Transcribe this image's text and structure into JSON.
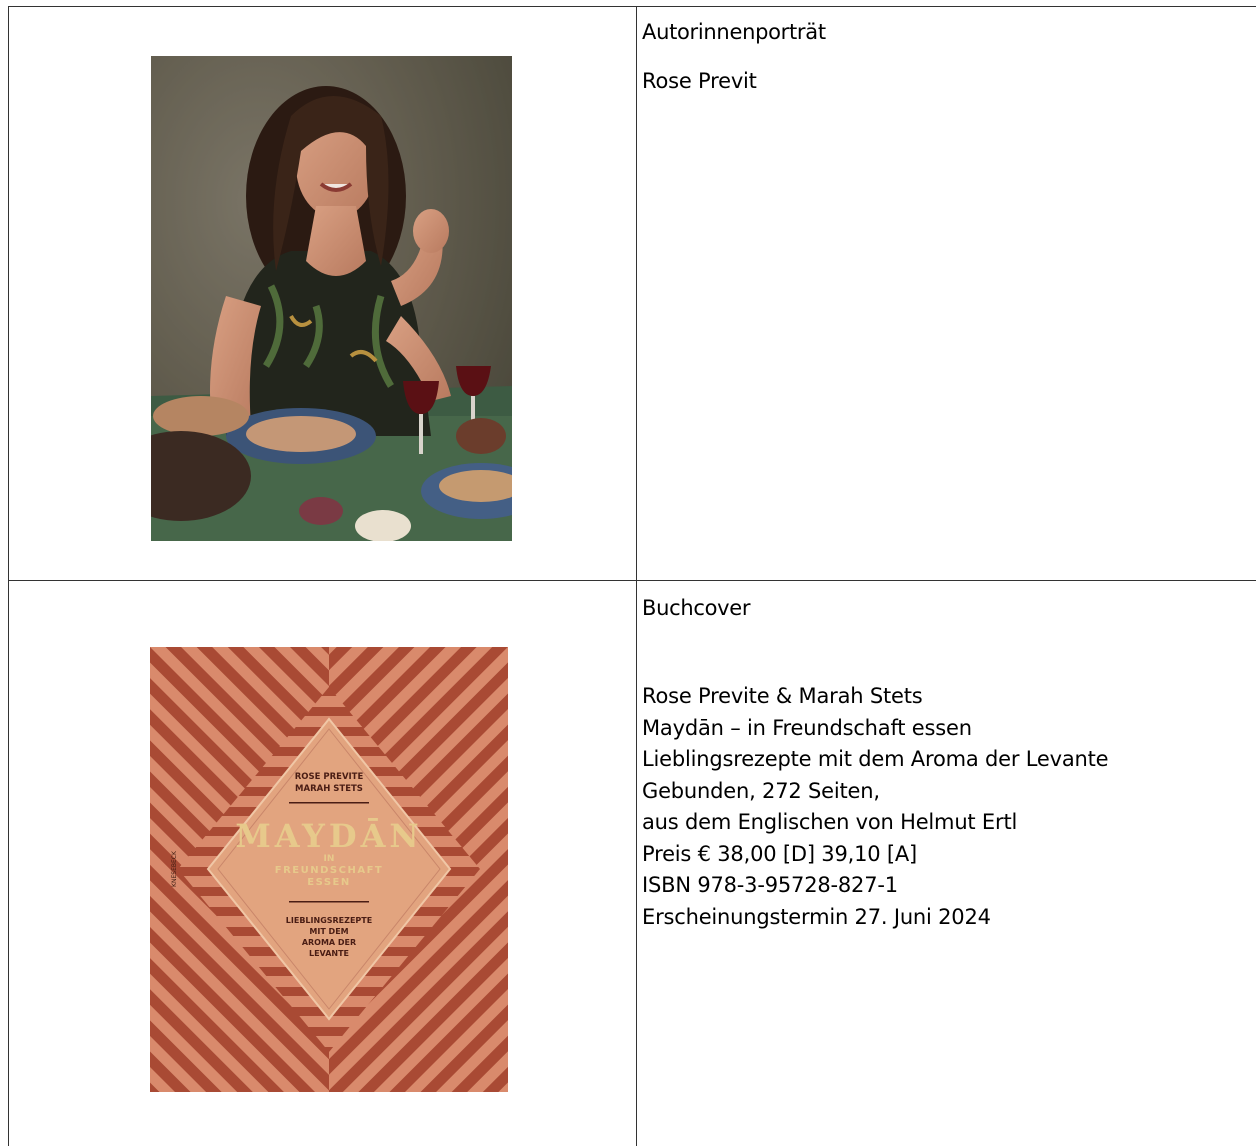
{
  "author_section": {
    "heading": "Autorinnenporträt",
    "name": "Rose Previt"
  },
  "book_section": {
    "heading": "Buchcover",
    "lines": [
      "Rose Previte & Marah Stets",
      "Maydān – in Freundschaft essen",
      "Lieblingsrezepte mit dem Aroma der Levante",
      "Gebunden, 272 Seiten,",
      "aus dem Englischen von Helmut Ertl",
      "Preis € 38,00 [D] 39,10 [A]",
      "ISBN 978-3-95728-827-1",
      "Erscheinungstermin 27. Juni 2024"
    ]
  },
  "cover": {
    "authors_line1": "ROSE PREVITE",
    "authors_line2": "MARAH STETS",
    "title": "MAYDĀN",
    "subtitle_line1": "IN",
    "subtitle_line2": "FREUNDSCHAFT",
    "subtitle_line3": "ESSEN",
    "tagline_line1": "LIEBLINGSREZEPTE",
    "tagline_line2": "MIT DEM",
    "tagline_line3": "AROMA DER",
    "tagline_line4": "LEVANTE",
    "publisher": "KNESEBECK"
  },
  "colors": {
    "cover_stripe": "#a94a34",
    "cover_bg": "#d98a6c",
    "cover_center": "#e2a47f",
    "cover_text_dark": "#4a1d14",
    "cover_title_gold": "#e7c98b"
  }
}
